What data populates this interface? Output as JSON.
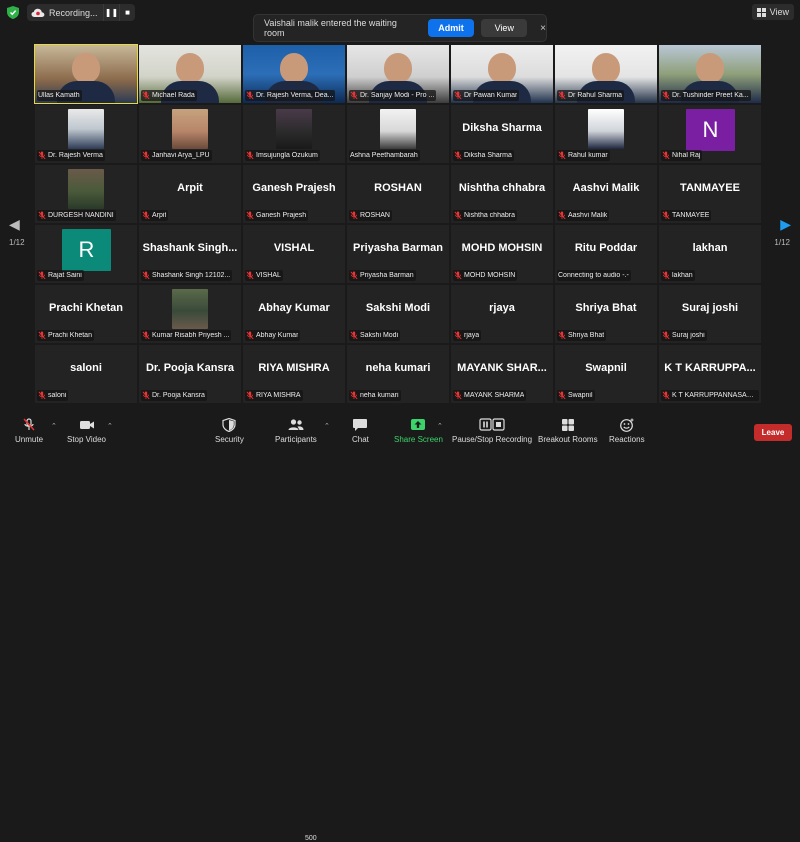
{
  "recording": {
    "label": "Recording...",
    "pause": "❚❚",
    "stop": "■"
  },
  "view_button": "View",
  "notification": {
    "message": "Vaishali malik entered the waiting room",
    "admit": "Admit",
    "view": "View",
    "close": "×"
  },
  "pagination": {
    "left": "1/12",
    "right": "1/12"
  },
  "tiles": [
    {
      "label": "Ullas Kamath",
      "kind": "video",
      "speaking": true,
      "muted": false
    },
    {
      "label": "Michael Rada",
      "kind": "video",
      "muted": true
    },
    {
      "label": "Dr. Rajesh Verma, Dea...",
      "kind": "video",
      "muted": true
    },
    {
      "label": "Dr. Sanjay Modi - Pro ...",
      "kind": "video",
      "muted": true
    },
    {
      "label": "Dr Pawan Kumar",
      "kind": "video",
      "muted": true
    },
    {
      "label": "Dr Rahul Sharma",
      "kind": "video",
      "muted": true
    },
    {
      "label": "Dr. Tushinder Preet Ka...",
      "kind": "video",
      "muted": true
    },
    {
      "label": "Dr. Rajesh Verma",
      "kind": "photo",
      "muted": true
    },
    {
      "label": "Janhavi Arya_LPU",
      "kind": "photo",
      "muted": true
    },
    {
      "label": "Imsujungla Ozukum",
      "kind": "photo",
      "muted": true
    },
    {
      "label": "Ashna Peethambarah",
      "kind": "photo",
      "muted": false
    },
    {
      "label": "Diksha Sharma",
      "big": "Diksha Sharma",
      "kind": "name",
      "muted": true
    },
    {
      "label": "Rahul kumar",
      "kind": "photo",
      "muted": true
    },
    {
      "label": "Nihal Raj",
      "kind": "avatar",
      "letter": "N",
      "color": "#7b1fa2",
      "muted": true
    },
    {
      "label": "DURGESH NANDINI",
      "kind": "photo",
      "muted": true
    },
    {
      "label": "Arpit",
      "big": "Arpit",
      "kind": "name",
      "muted": true
    },
    {
      "label": "Ganesh Prajesh",
      "big": "Ganesh Prajesh",
      "kind": "name",
      "muted": true
    },
    {
      "label": "ROSHAN",
      "big": "ROSHAN",
      "kind": "name",
      "muted": true
    },
    {
      "label": "Nishtha  chhabra",
      "big": "Nishtha  chhabra",
      "kind": "name",
      "muted": true
    },
    {
      "label": "Aashvi Malik",
      "big": "Aashvi Malik",
      "kind": "name",
      "muted": true
    },
    {
      "label": "TANMAYEE",
      "big": "TANMAYEE",
      "kind": "name",
      "muted": true
    },
    {
      "label": "Rajat Saini",
      "kind": "avatar",
      "letter": "R",
      "color": "#0b8a7a",
      "muted": true
    },
    {
      "label": "Shashank Singh 12102...",
      "big": "Shashank  Singh...",
      "kind": "name",
      "muted": true
    },
    {
      "label": "VISHAL",
      "big": "VISHAL",
      "kind": "name",
      "muted": true
    },
    {
      "label": "Priyasha Barman",
      "big": "Priyasha Barman",
      "kind": "name",
      "muted": true
    },
    {
      "label": "MOHD MOHSIN",
      "big": "MOHD MOHSIN",
      "kind": "name",
      "muted": true
    },
    {
      "label": "Connecting to audio -.-",
      "big": "Ritu Poddar",
      "kind": "name",
      "muted": false,
      "nomic": true
    },
    {
      "label": "lakhan",
      "big": "lakhan",
      "kind": "name",
      "muted": true
    },
    {
      "label": "Prachi Khetan",
      "big": "Prachi Khetan",
      "kind": "name",
      "muted": true
    },
    {
      "label": "Kumar Risabh Priyesh ...",
      "kind": "photo",
      "muted": true
    },
    {
      "label": "Abhay Kumar",
      "big": "Abhay Kumar",
      "kind": "name",
      "muted": true
    },
    {
      "label": "Sakshi Modi",
      "big": "Sakshi Modi",
      "kind": "name",
      "muted": true
    },
    {
      "label": "rjaya",
      "big": "rjaya",
      "kind": "name",
      "muted": true
    },
    {
      "label": "Shriya Bhat",
      "big": "Shriya Bhat",
      "kind": "name",
      "muted": true
    },
    {
      "label": "Suraj joshi",
      "big": "Suraj joshi",
      "kind": "name",
      "muted": true
    },
    {
      "label": "saloni",
      "big": "saloni",
      "kind": "name",
      "muted": true
    },
    {
      "label": "Dr. Pooja Kansra",
      "big": "Dr. Pooja Kansra",
      "kind": "name",
      "muted": true
    },
    {
      "label": "RIYA MISHRA",
      "big": "RIYA MISHRA",
      "kind": "name",
      "muted": true
    },
    {
      "label": "neha kumari",
      "big": "neha kumari",
      "kind": "name",
      "muted": true
    },
    {
      "label": "MAYANK SHARMA",
      "big": "MAYANK  SHAR...",
      "kind": "name",
      "muted": true
    },
    {
      "label": "Swapnil",
      "big": "Swapnil",
      "kind": "name",
      "muted": true
    },
    {
      "label": "K T KARRUPPANNASAMY",
      "big": "K T KARRUPPA...",
      "kind": "name",
      "muted": true
    }
  ],
  "toolbar": {
    "unmute": "Unmute",
    "stop_video": "Stop Video",
    "security": "Security",
    "participants": "Participants",
    "participant_count": "500",
    "chat": "Chat",
    "share_screen": "Share Screen",
    "pause_stop_recording": "Pause/Stop Recording",
    "breakout_rooms": "Breakout Rooms",
    "reactions": "Reactions",
    "leave": "Leave"
  },
  "colors": {
    "accent_blue": "#0e72ed",
    "share_green": "#3dd36b",
    "leave_red": "#c42b2b",
    "speaker_yellow": "#e6d840"
  }
}
